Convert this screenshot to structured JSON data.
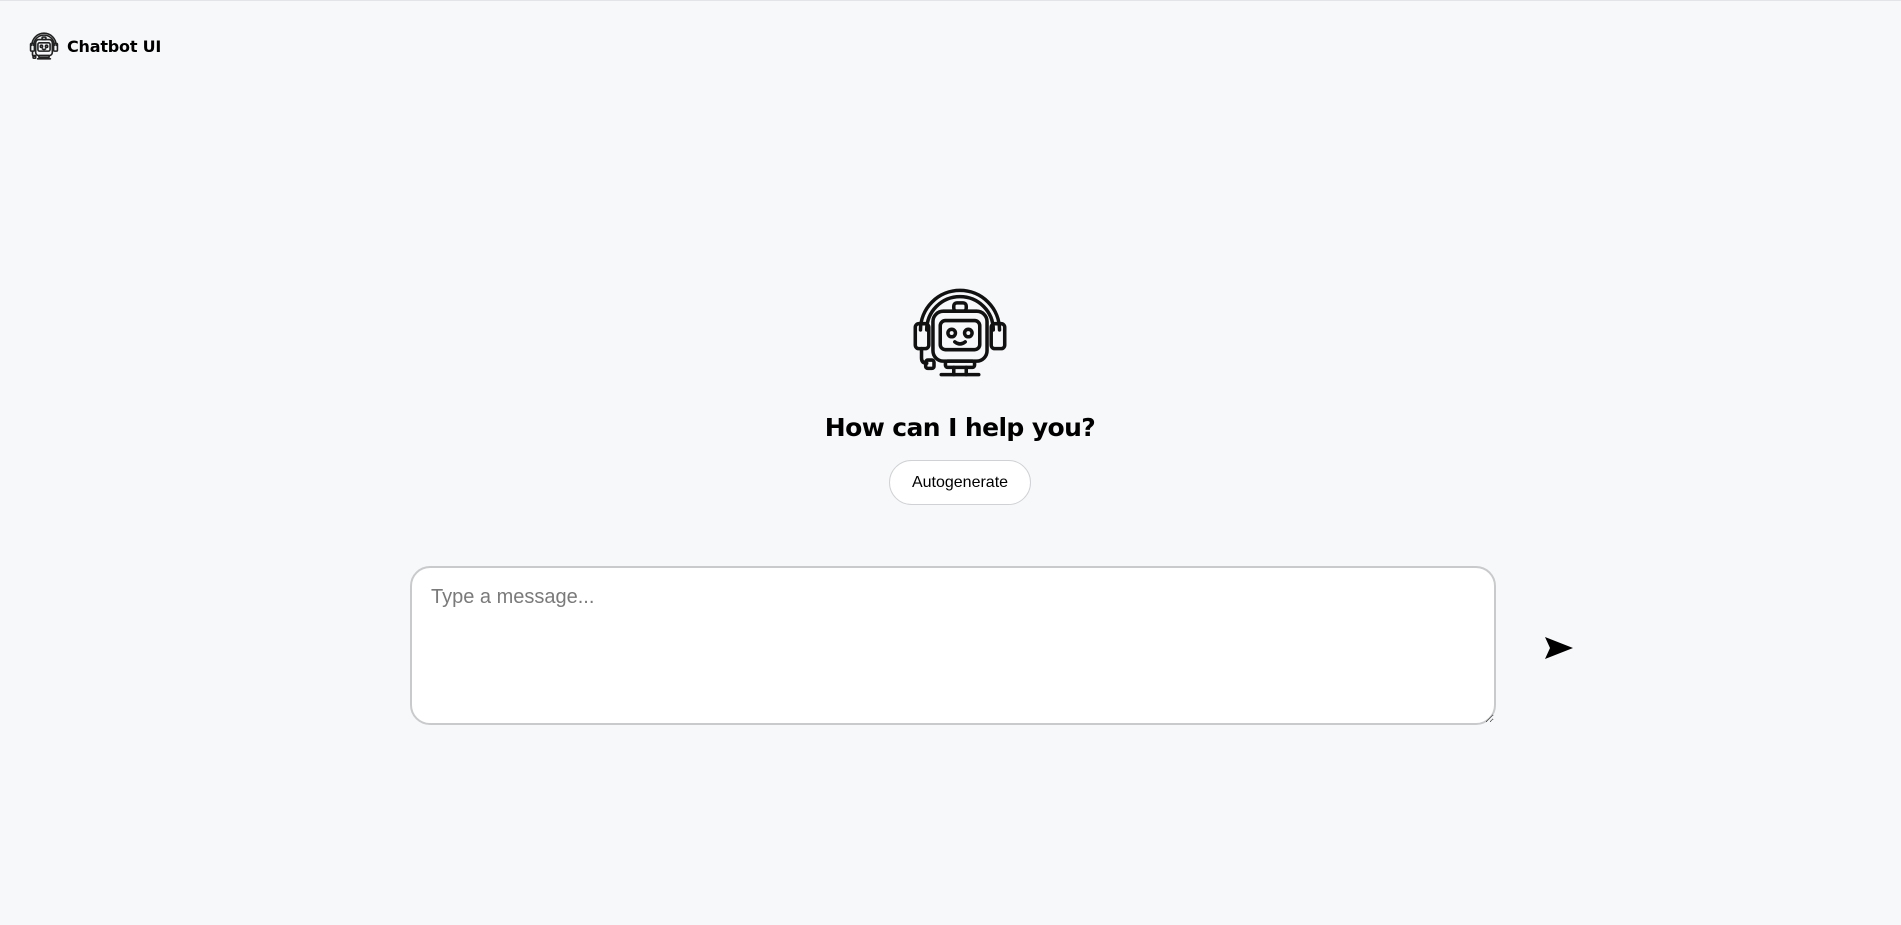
{
  "header": {
    "app_name": "Chatbot UI",
    "logo_icon": "robot-headset-icon"
  },
  "main": {
    "hero_icon": "robot-headset-icon",
    "greeting": "How can I help you?",
    "autogenerate_label": "Autogenerate"
  },
  "composer": {
    "value": "",
    "placeholder": "Type a message...",
    "send_icon": "send-arrow-icon"
  },
  "colors": {
    "background": "#f7f8fa",
    "input_border": "#c9cacc",
    "text": "#000000"
  }
}
